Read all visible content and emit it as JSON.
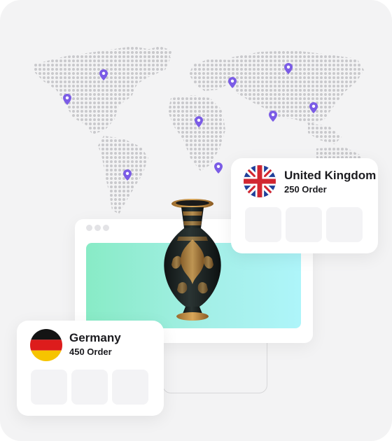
{
  "cards": {
    "uk": {
      "country": "United Kingdom",
      "orders": "250 Order",
      "flag": "uk-flag"
    },
    "germany": {
      "country": "Germany",
      "orders": "450 Order",
      "flag": "germany-flag"
    }
  },
  "colors": {
    "background": "#f3f3f4",
    "map_dot": "#c9c9cc",
    "pin": "#7b5ce6",
    "hero_gradient": [
      "#88ebc6",
      "#aef5fa"
    ]
  },
  "icons": [
    "location-pin-icon",
    "uk-flag-icon",
    "germany-flag-icon",
    "vase-image"
  ]
}
